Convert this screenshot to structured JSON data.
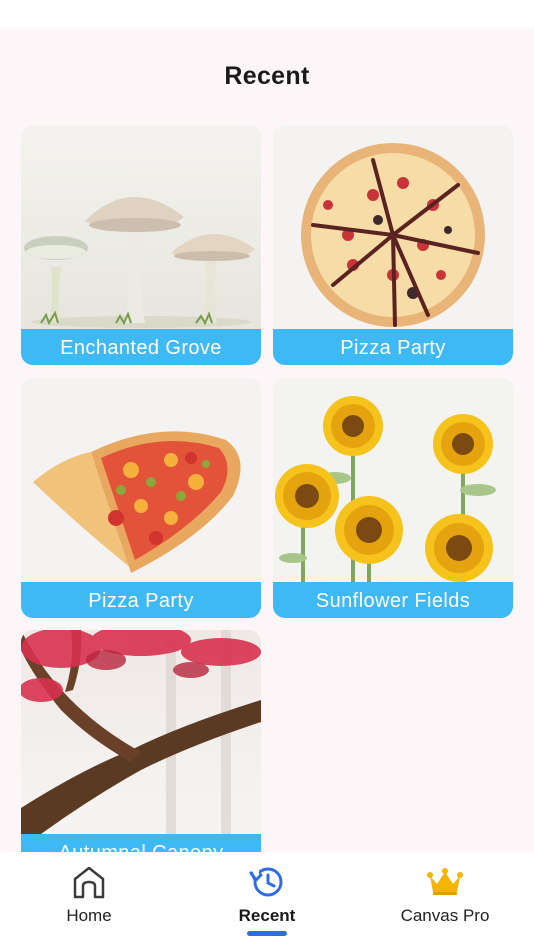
{
  "header": {
    "title": "Recent"
  },
  "recent_items": [
    {
      "label": "Enchanted Grove"
    },
    {
      "label": "Pizza Party"
    },
    {
      "label": "Pizza Party"
    },
    {
      "label": "Sunflower Fields"
    },
    {
      "label": "Autumnal Canopy"
    }
  ],
  "tabbar": {
    "tabs": [
      {
        "label": "Home",
        "icon": "home-icon"
      },
      {
        "label": "Recent",
        "icon": "history-icon"
      },
      {
        "label": "Canvas Pro",
        "icon": "crown-icon"
      }
    ],
    "active": "Recent"
  },
  "colors": {
    "accent": "#3fb9f4",
    "active_tab": "#2f6ce8",
    "crown": "#f5b400",
    "background": "#fdf6f8"
  }
}
